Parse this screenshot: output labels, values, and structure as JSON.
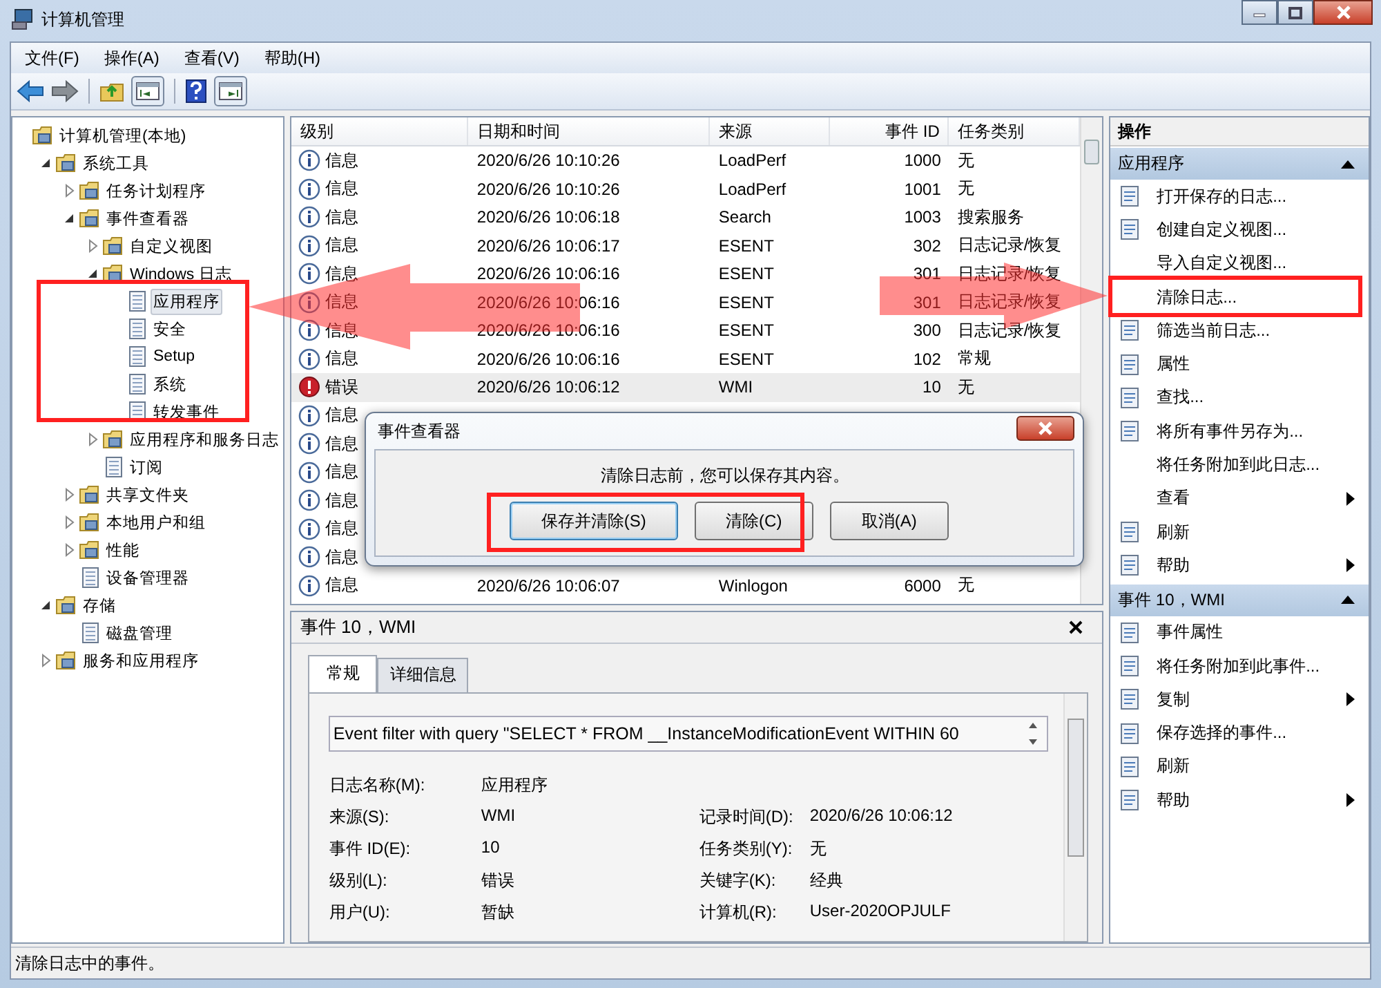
{
  "window": {
    "title": "计算机管理"
  },
  "menu": [
    "文件(F)",
    "操作(A)",
    "查看(V)",
    "帮助(H)"
  ],
  "tree": [
    {
      "label": "计算机管理(本地)",
      "selected": false,
      "children": [
        {
          "label": "系统工具",
          "expanded": true,
          "selected": false,
          "children": [
            {
              "label": "任务计划程序",
              "expanded": false,
              "selected": false
            },
            {
              "label": "事件查看器",
              "expanded": true,
              "selected": false,
              "children": [
                {
                  "label": "自定义视图",
                  "expanded": false,
                  "selected": false
                },
                {
                  "label": "Windows 日志",
                  "expanded": true,
                  "selected": false,
                  "children": [
                    {
                      "label": "应用程序",
                      "selected": true
                    },
                    {
                      "label": "安全",
                      "selected": false
                    },
                    {
                      "label": "Setup",
                      "selected": false
                    },
                    {
                      "label": "系统",
                      "selected": false
                    },
                    {
                      "label": "转发事件",
                      "selected": false
                    }
                  ]
                },
                {
                  "label": "应用程序和服务日志",
                  "expanded": false,
                  "selected": false
                },
                {
                  "label": "订阅",
                  "selected": false
                }
              ]
            },
            {
              "label": "共享文件夹",
              "expanded": false,
              "selected": false
            },
            {
              "label": "本地用户和组",
              "expanded": false,
              "selected": false
            },
            {
              "label": "性能",
              "expanded": false,
              "selected": false
            },
            {
              "label": "设备管理器",
              "selected": false
            }
          ]
        },
        {
          "label": "存储",
          "expanded": true,
          "selected": false,
          "children": [
            {
              "label": "磁盘管理",
              "selected": false
            }
          ]
        },
        {
          "label": "服务和应用程序",
          "expanded": false,
          "selected": false
        }
      ]
    }
  ],
  "events": {
    "columns": [
      "级别",
      "日期和时间",
      "来源",
      "事件 ID",
      "任务类别"
    ],
    "rows": [
      {
        "kind": "info",
        "level": "信息",
        "date": "2020/6/26 10:10:26",
        "source": "LoadPerf",
        "id": "1000",
        "category": "无",
        "selected": false
      },
      {
        "kind": "info",
        "level": "信息",
        "date": "2020/6/26 10:10:26",
        "source": "LoadPerf",
        "id": "1001",
        "category": "无",
        "selected": false
      },
      {
        "kind": "info",
        "level": "信息",
        "date": "2020/6/26 10:06:18",
        "source": "Search",
        "id": "1003",
        "category": "搜索服务",
        "selected": false
      },
      {
        "kind": "info",
        "level": "信息",
        "date": "2020/6/26 10:06:17",
        "source": "ESENT",
        "id": "302",
        "category": "日志记录/恢复",
        "selected": false
      },
      {
        "kind": "info",
        "level": "信息",
        "date": "2020/6/26 10:06:16",
        "source": "ESENT",
        "id": "301",
        "category": "日志记录/恢复",
        "selected": false
      },
      {
        "kind": "info",
        "level": "信息",
        "date": "2020/6/26 10:06:16",
        "source": "ESENT",
        "id": "301",
        "category": "日志记录/恢复",
        "selected": false
      },
      {
        "kind": "info",
        "level": "信息",
        "date": "2020/6/26 10:06:16",
        "source": "ESENT",
        "id": "300",
        "category": "日志记录/恢复",
        "selected": false
      },
      {
        "kind": "info",
        "level": "信息",
        "date": "2020/6/26 10:06:16",
        "source": "ESENT",
        "id": "102",
        "category": "常规",
        "selected": false
      },
      {
        "kind": "error",
        "level": "错误",
        "date": "2020/6/26 10:06:12",
        "source": "WMI",
        "id": "10",
        "category": "无",
        "selected": true
      },
      {
        "kind": "info",
        "level": "信息",
        "selected": false
      },
      {
        "kind": "info",
        "level": "信息",
        "selected": false
      },
      {
        "kind": "info",
        "level": "信息",
        "selected": false
      },
      {
        "kind": "info",
        "level": "信息",
        "selected": false
      },
      {
        "kind": "info",
        "level": "信息",
        "selected": false
      },
      {
        "kind": "info",
        "level": "信息",
        "selected": false
      },
      {
        "kind": "info",
        "level": "信息",
        "date": "2020/6/26 10:06:07",
        "source": "Winlogon",
        "id": "6000",
        "category": "无",
        "selected": false
      }
    ]
  },
  "dialog": {
    "title": "事件查看器",
    "message": "清除日志前，您可以保存其内容。",
    "buttons": [
      "保存并清除(S)",
      "清除(C)",
      "取消(A)"
    ]
  },
  "detail": {
    "title": "事件 10，WMI",
    "tabs": [
      {
        "label": "常规",
        "selected": true
      },
      {
        "label": "详细信息",
        "selected": false
      }
    ],
    "description": "Event filter with query \"SELECT * FROM __InstanceModificationEvent WITHIN 60",
    "rows": [
      {
        "left": {
          "label": "日志名称(M):",
          "value": "应用程序"
        }
      },
      {
        "left": {
          "label": "来源(S):",
          "value": "WMI"
        },
        "right": {
          "label": "记录时间(D):",
          "value": "2020/6/26 10:06:12"
        }
      },
      {
        "left": {
          "label": "事件 ID(E):",
          "value": "10"
        },
        "right": {
          "label": "任务类别(Y):",
          "value": "无"
        }
      },
      {
        "left": {
          "label": "级别(L):",
          "value": "错误"
        },
        "right": {
          "label": "关键字(K):",
          "value": "经典"
        }
      },
      {
        "left": {
          "label": "用户(U):",
          "value": "暂缺"
        },
        "right": {
          "label": "计算机(R):",
          "value": "User-2020OPJULF"
        }
      }
    ]
  },
  "actions": {
    "title": "操作",
    "sections": [
      {
        "title": "应用程序",
        "items": [
          {
            "label": "打开保存的日志...",
            "icon": true,
            "submenu": false
          },
          {
            "label": "创建自定义视图...",
            "icon": true,
            "submenu": false
          },
          {
            "label": "导入自定义视图...",
            "icon": false,
            "submenu": false
          },
          {
            "label": "清除日志...",
            "icon": false,
            "submenu": false
          },
          {
            "label": "筛选当前日志...",
            "icon": true,
            "submenu": false
          },
          {
            "label": "属性",
            "icon": true,
            "submenu": false
          },
          {
            "label": "查找...",
            "icon": true,
            "submenu": false
          },
          {
            "label": "将所有事件另存为...",
            "icon": true,
            "submenu": false
          },
          {
            "label": "将任务附加到此日志...",
            "icon": false,
            "submenu": false
          },
          {
            "label": "查看",
            "icon": false,
            "submenu": true
          },
          {
            "label": "刷新",
            "icon": true,
            "submenu": false
          },
          {
            "label": "帮助",
            "icon": true,
            "submenu": true
          }
        ]
      },
      {
        "title": "事件 10，WMI",
        "items": [
          {
            "label": "事件属性",
            "icon": true,
            "submenu": false
          },
          {
            "label": "将任务附加到此事件...",
            "icon": true,
            "submenu": false
          },
          {
            "label": "复制",
            "icon": true,
            "submenu": true
          },
          {
            "label": "保存选择的事件...",
            "icon": true,
            "submenu": false
          },
          {
            "label": "刷新",
            "icon": true,
            "submenu": false
          },
          {
            "label": "帮助",
            "icon": true,
            "submenu": true
          }
        ]
      }
    ]
  },
  "status_bar": "清除日志中的事件。"
}
